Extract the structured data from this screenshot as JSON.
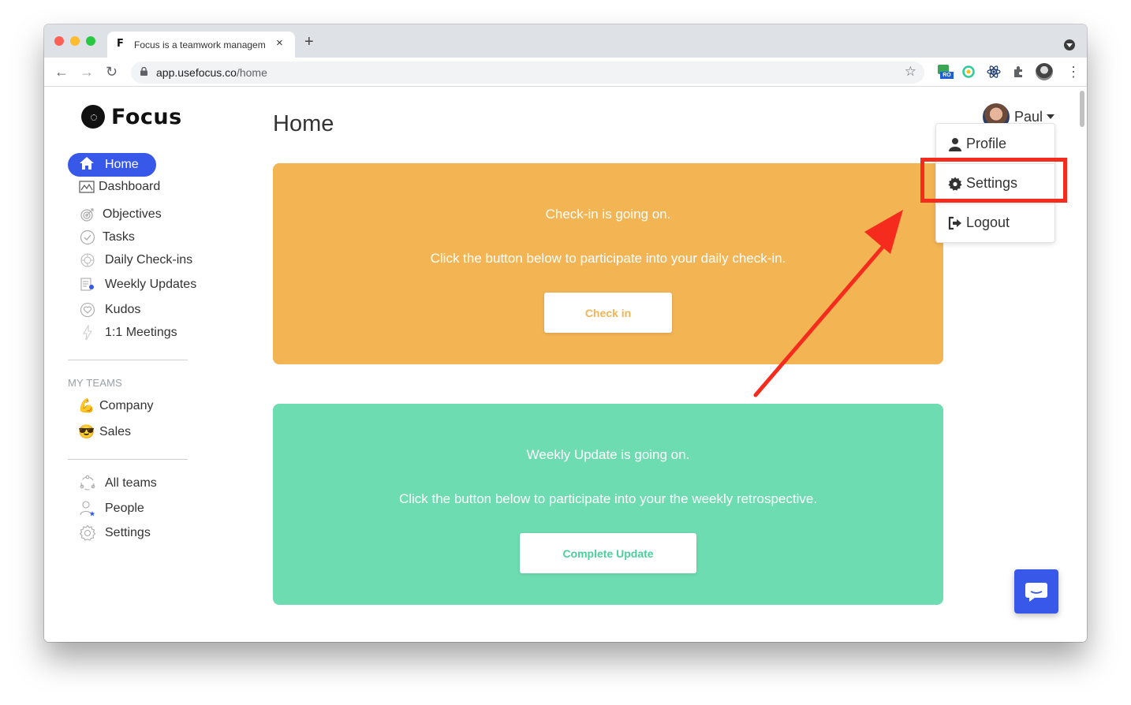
{
  "browser": {
    "tab_favicon": "F",
    "tab_title": "Focus is a teamwork managem",
    "tab_close": "×",
    "new_tab": "+",
    "url_host": "app.usefocus.co",
    "url_path": "/home",
    "bookmark_star": "☆",
    "menu": "⋮",
    "ext_badge": "RO"
  },
  "app": {
    "logo": "Focus",
    "page_title": "Home"
  },
  "sidebar": {
    "home": "Home",
    "items": [
      {
        "label": "Dashboard",
        "icon": "dashboard-icon"
      },
      {
        "label": "Objectives",
        "icon": "target-icon"
      },
      {
        "label": "Tasks",
        "icon": "check-circle-icon"
      },
      {
        "label": "Daily Check-ins",
        "icon": "checkin-icon"
      },
      {
        "label": "Weekly Updates",
        "icon": "weekly-updates-icon"
      },
      {
        "label": "Kudos",
        "icon": "heart-icon"
      },
      {
        "label": "1:1 Meetings",
        "icon": "bolt-icon"
      }
    ],
    "my_teams_label": "MY TEAMS",
    "teams": [
      {
        "emoji": "💪",
        "label": "Company"
      },
      {
        "emoji": "😎",
        "label": "Sales"
      }
    ],
    "footer": [
      {
        "label": "All teams",
        "icon": "all-teams-icon"
      },
      {
        "label": "People",
        "icon": "people-icon"
      },
      {
        "label": "Settings",
        "icon": "gear-icon"
      }
    ]
  },
  "user": {
    "name": "Paul",
    "menu": {
      "profile": "Profile",
      "settings": "Settings",
      "logout": "Logout"
    }
  },
  "cards": {
    "checkin": {
      "line1": "Check-in is going on.",
      "line2": "Click the button below to participate into your daily check-in.",
      "button": "Check in",
      "color": "#f3b454"
    },
    "weekly": {
      "line1": "Weekly Update is going on.",
      "line2": "Click the button below to participate into your the weekly retrospective.",
      "button": "Complete Update",
      "color": "#6ddcb1"
    }
  },
  "colors": {
    "accent": "#3858e9",
    "annotation": "#f52c1d"
  }
}
